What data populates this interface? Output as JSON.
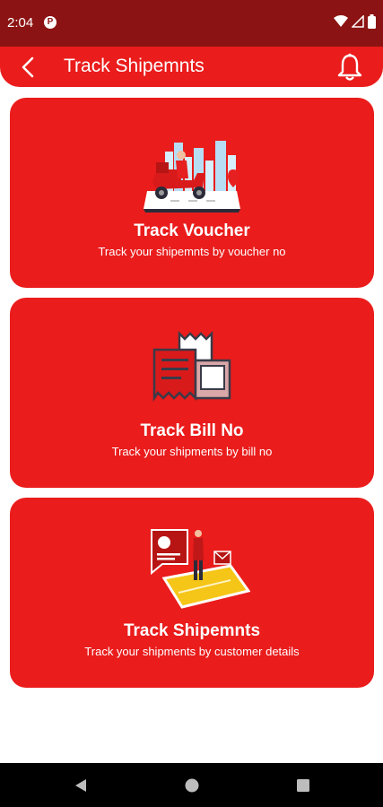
{
  "status_bar": {
    "time": "2:04",
    "app_icon_letter": "P"
  },
  "header": {
    "title": "Track Shipemnts"
  },
  "cards": [
    {
      "title": "Track Voucher",
      "subtitle": "Track your shipemnts by voucher no",
      "icon": "scooter-delivery-icon"
    },
    {
      "title": "Track Bill No",
      "subtitle": "Track your shipments by bill no",
      "icon": "bill-receipt-icon"
    },
    {
      "title": "Track Shipemnts",
      "subtitle": "Track your shipments by customer details",
      "icon": "map-phone-icon"
    }
  ],
  "colors": {
    "primary": "#ea1c1c",
    "status_bar": "#8c1313",
    "nav_bar": "#000000",
    "accent_yellow": "#f5c518"
  }
}
